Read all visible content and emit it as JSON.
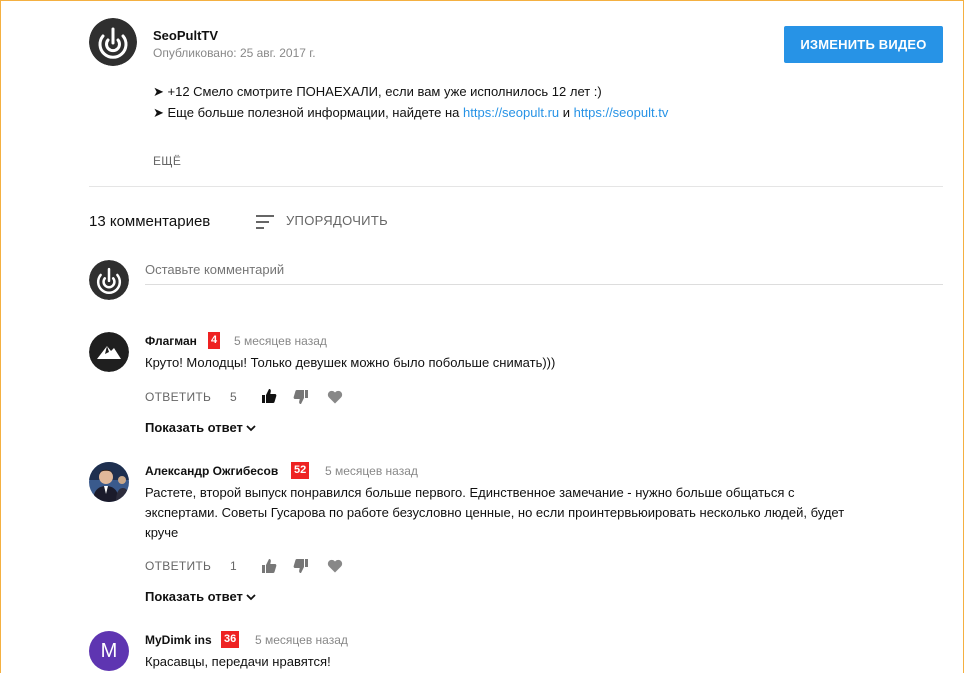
{
  "channel": {
    "name": "SeoPultTV",
    "published": "Опубликовано: 25 авг. 2017 г.",
    "edit_button": "ИЗМЕНИТЬ ВИДЕО"
  },
  "description": {
    "line1": "➤ +12 Смело смотрите ПОНАЕХАЛИ, если вам уже исполнилось 12 лет :)",
    "line2_prefix": "➤ Еще больше полезной информации, найдете на ",
    "link1": "https://seopult.ru",
    "line2_mid": " и ",
    "link2": "https://seopult.tv",
    "more": "ЕЩЁ"
  },
  "comments_header": {
    "count": "13 комментариев",
    "sort_label": "УПОРЯДОЧИТЬ"
  },
  "comment_box": {
    "placeholder": "Оставьте комментарий"
  },
  "comments": [
    {
      "author": "Флагман",
      "badge": "4",
      "time": "5 месяцев назад",
      "text": "Круто! Молодцы! Только девушек можно было побольше снимать)))",
      "reply": "ОТВЕТИТЬ",
      "likes": "5",
      "show_replies": "Показать ответ"
    },
    {
      "author": "Александр Ожгибесов",
      "badge": "52",
      "time": "5 месяцев назад",
      "text": "Растете, второй выпуск понравился больше первого. Единственное замечание - нужно больше общаться с экспертами. Советы Гусарова по работе безусловно ценные, но если проинтервьюировать несколько людей, будет круче",
      "reply": "ОТВЕТИТЬ",
      "likes": "1",
      "show_replies": "Показать ответ"
    },
    {
      "author": "MyDimk ins",
      "badge": "36",
      "time": "5 месяцев назад",
      "text": "Красавцы, передачи нравятся!",
      "avatar_letter": "M"
    }
  ],
  "colors": {
    "accent": "#2793e6",
    "badge": "#e22222",
    "avatar_purple": "#5e35b1"
  }
}
